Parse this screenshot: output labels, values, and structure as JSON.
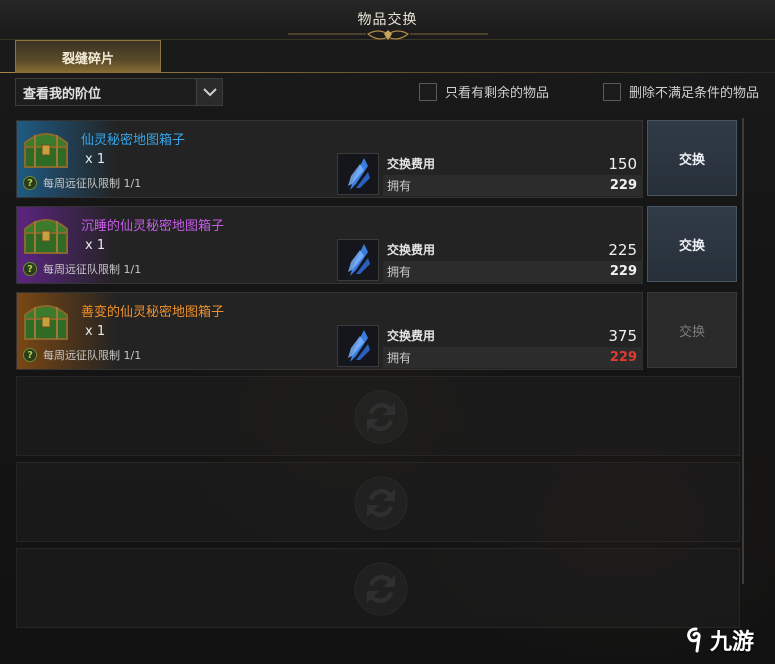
{
  "window": {
    "title": "物品交换"
  },
  "tabs": [
    {
      "label": "裂缝碎片"
    }
  ],
  "filters": {
    "rank_select": "查看我的阶位",
    "only_remaining": "只看有剩余的物品",
    "remove_unmet": "删除不满足条件的物品"
  },
  "items": [
    {
      "name": "仙灵秘密地图箱子",
      "name_color": "#38a6e8",
      "rarity_color": "#1f5a83",
      "qty": "x 1",
      "limit": "每周远征队限制 1/1",
      "cost_label": "交换费用",
      "cost": "150",
      "own_label": "拥有",
      "own": "229",
      "button": "交换",
      "enabled": true
    },
    {
      "name": "沉睡的仙灵秘密地图箱子",
      "name_color": "#c65ce8",
      "rarity_color": "#5b2580",
      "qty": "x 1",
      "limit": "每周远征队限制 1/1",
      "cost_label": "交换费用",
      "cost": "225",
      "own_label": "拥有",
      "own": "229",
      "button": "交换",
      "enabled": true
    },
    {
      "name": "善变的仙灵秘密地图箱子",
      "name_color": "#f0902a",
      "rarity_color": "#7a4714",
      "qty": "x 1",
      "limit": "每周远征队限制 1/1",
      "cost_label": "交换费用",
      "cost": "375",
      "own_label": "拥有",
      "own": "229",
      "button": "交换",
      "enabled": false
    }
  ],
  "watermark": {
    "text": "九游"
  }
}
